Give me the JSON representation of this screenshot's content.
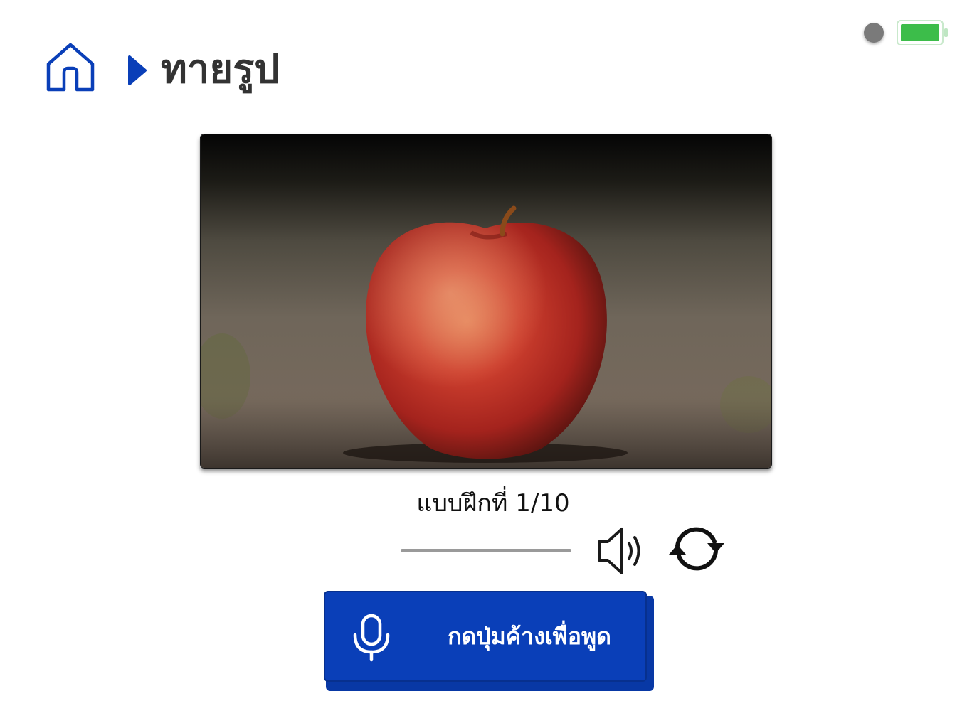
{
  "status": {
    "recording_indicator_color": "#7a7a7a",
    "battery_color": "#3cbd4a",
    "battery_level": 1.0
  },
  "header": {
    "home_icon": "home-icon",
    "separator_icon": "chevron-right-icon",
    "title": "ทายรูป"
  },
  "picture": {
    "subject": "apple-photo"
  },
  "exercise": {
    "counter": "แบบฝึกที่ 1/10",
    "progress": 1.0
  },
  "controls": {
    "speaker_icon": "speaker-icon",
    "refresh_icon": "refresh-icon"
  },
  "speak_button": {
    "icon": "microphone-icon",
    "label": "กดปุ่มค้างเพื่อพูด"
  },
  "colors": {
    "accent": "#0a3fb8",
    "accent_dark": "#07308e",
    "title": "#333333"
  }
}
